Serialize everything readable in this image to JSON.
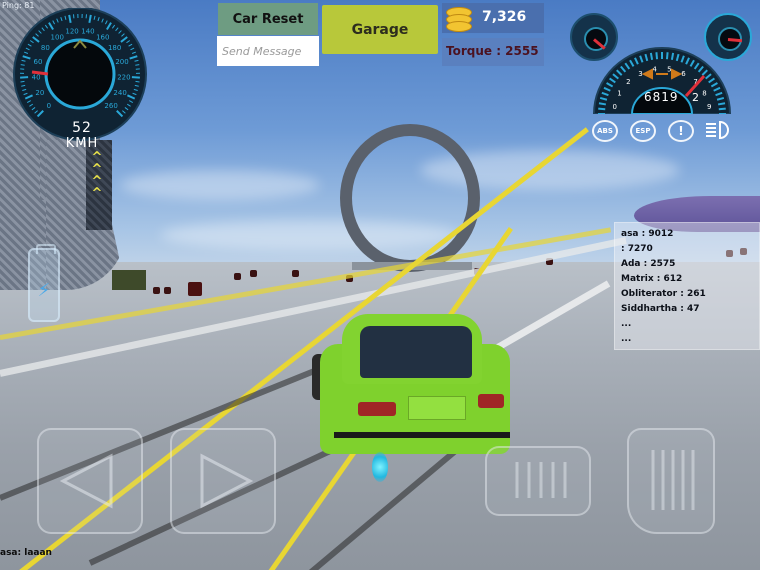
{
  "hud": {
    "ping": "Ping: 81",
    "speed": {
      "value": "52",
      "unit": "KMH",
      "ticks": [
        "0",
        "20",
        "40",
        "60",
        "80",
        "100",
        "120",
        "140",
        "160",
        "180",
        "200",
        "220",
        "240",
        "260"
      ]
    },
    "buttons": {
      "car_reset": "Car Reset",
      "garage": "Garage"
    },
    "message": {
      "placeholder": "Send Message",
      "value": ""
    },
    "coins": "7,326",
    "torque": "Torque : 2555",
    "tachometer": {
      "rpm": "6819",
      "gear": "2",
      "ticks": [
        "0",
        "1",
        "2",
        "3",
        "4",
        "5",
        "6",
        "7",
        "8",
        "9"
      ]
    },
    "indicators": [
      {
        "icon": "abs-icon",
        "label": "ABS"
      },
      {
        "icon": "esp-icon",
        "label": "ESP"
      },
      {
        "icon": "warning-icon",
        "label": "!"
      },
      {
        "icon": "headlight-icon",
        "label": ""
      }
    ],
    "leaderboard": [
      {
        "name": "asa",
        "score": "9012"
      },
      {
        "name": "",
        "score": "7270"
      },
      {
        "name": "Ada",
        "score": "2575"
      },
      {
        "name": "Matrix",
        "score": "612"
      },
      {
        "name": "Obliterator",
        "score": "261"
      },
      {
        "name": "Siddhartha",
        "score": "47"
      },
      {
        "name": "...",
        "score": ""
      },
      {
        "name": "...",
        "score": ""
      }
    ],
    "leaderboard_text": [
      "asa :  9012",
      " :  7270",
      "Ada :  2575",
      "Matrix :  612",
      "Obliterator :  261",
      "Siddhartha :  47",
      "...",
      "..."
    ],
    "chat": "asa: laaan",
    "controls": {
      "left": "steer-left",
      "right": "steer-right",
      "brake": "brake-pedal",
      "gas": "gas-pedal"
    },
    "colors": {
      "garage_bg": "#b8c83a",
      "reset_bg": "#6e9c82",
      "torque_text": "#4b1220",
      "car": "#7fd12d",
      "gauge_accent": "#2aa8d8",
      "needle": "#e0303a"
    }
  }
}
